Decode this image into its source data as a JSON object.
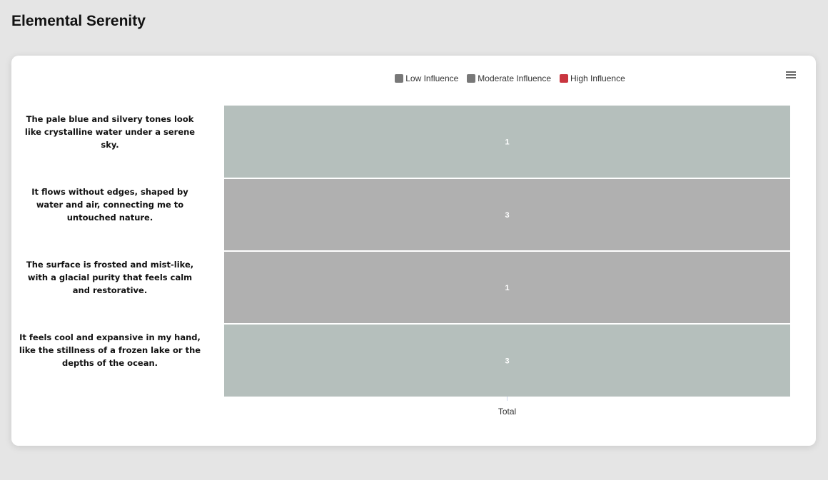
{
  "page": {
    "title": "Elemental Serenity"
  },
  "legend": [
    {
      "label": "Low Influence",
      "color": "#787878"
    },
    {
      "label": "Moderate Influence",
      "color": "#787878"
    },
    {
      "label": "High Influence",
      "color": "#c9353f"
    }
  ],
  "icons": {
    "menu": "hamburger-menu-icon"
  },
  "chart_data": {
    "type": "bar",
    "orientation": "horizontal",
    "stacked": true,
    "categories": [
      "The pale blue and silvery tones look like crystalline water under a serene sky.",
      "It flows without edges, shaped by water and air, connecting me to untouched nature.",
      "The surface is frosted and mist-like, with a glacial purity that feels calm and restorative.",
      "It feels cool and expansive in my hand, like the stillness of a frozen lake or the depths of the ocean."
    ],
    "values": [
      1,
      3,
      1,
      3
    ],
    "bar_colors": [
      "#b5bfbc",
      "#b0b0b0",
      "#b0b0b0",
      "#b5bfbc"
    ],
    "xlabel": "Total",
    "data_labels": [
      "1",
      "3",
      "1",
      "3"
    ],
    "legend_position": "top-center",
    "grid": false
  }
}
